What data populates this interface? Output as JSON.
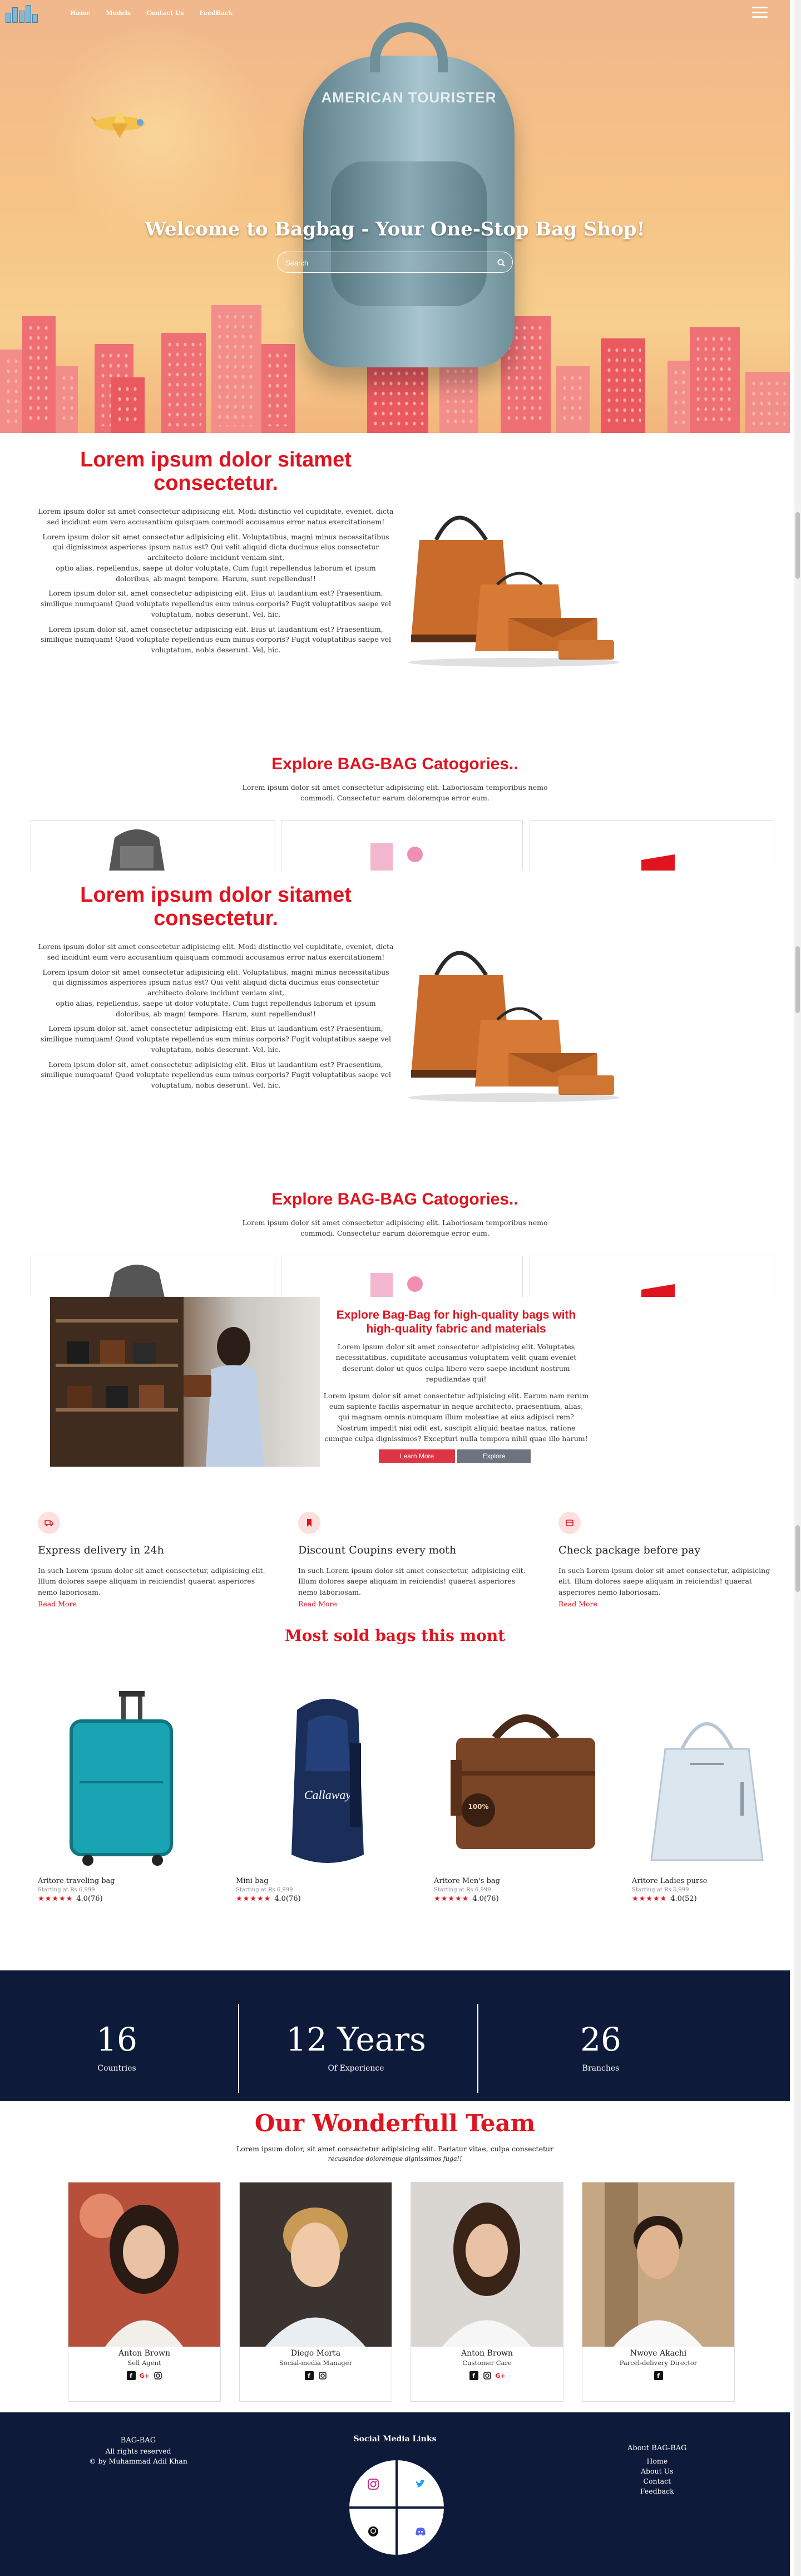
{
  "nav": {
    "links": [
      "Home",
      "Models",
      "Contact Us",
      "FeedBack"
    ]
  },
  "hero": {
    "title": "Welcome to Bagbag - Your One-Stop Bag Shop!",
    "search_placeholder": "Search",
    "backpack_brand": "AMERICAN TOURISTER"
  },
  "about": {
    "title": "Lorem ipsum dolor sitamet consectetur.",
    "paragraphs": [
      "Lorem ipsum dolor sit amet consectetur adipisicing elit. Modi distinctio vel cupiditate, eveniet, dicta sed incidunt eum vero accusantium quisquam commodi accusamus error natus exercitationem!",
      "Lorem ipsum dolor sit amet consectetur adipisicing elit. Voluptatibus, magni minus necessitatibus qui dignissimos asperiores ipsum natus est? Qui velit aliquid dicta ducimus eius consectetur architecto dolore incidunt veniam sint,",
      "optio alias, repellendus, saepe ut dolor voluptate. Cum fugit repellendus laborum et ipsum doloribus, ab magni tempore. Harum, sunt repellendus!!",
      "Lorem ipsum dolor sit, amet consectetur adipisicing elit. Eius ut laudantium est? Praesentium, similique numquam! Quod voluptate repellendus eum minus corporis? Fugit voluptatibus saepe vel voluptatum, nobis deserunt. Vel, hic.",
      "Lorem ipsum dolor sit, amet consectetur adipisicing elit. Eius ut laudantium est? Praesentium, similique numquam! Quod voluptate repellendus eum minus corporis? Fugit voluptatibus saepe vel voluptatum, nobis deserunt. Vel, hic."
    ]
  },
  "categories": {
    "title": "Explore BAG-BAG Catogories..",
    "subtitle": "Lorem ipsum dolor sit amet consectetur adipisicing elit. Laboriosam temporibus nemo commodi. Consectetur earum doloremque error eum."
  },
  "promo": {
    "title": "Explore Bag-Bag for high-quality bags with high-quality fabric and materials",
    "paragraphs": [
      "Lorem ipsum dolor sit amet consectetur adipisicing elit. Voluptates necessitatibus, cupiditate accusamus voluptatem velit quam eveniet deserunt dolor ut quos culpa libero vero saepe incidunt nostrum repudiandae qui!",
      "Lorem ipsum dolor sit amet consectetur adipisicing elit. Earum nam rerum eum sapiente facilis aspernatur in neque architecto, praesentium, alias, qui magnam omnis numquam illum molestiae at eius adipisci rem? Nostrum impedit nisi odit est, suscipit aliquid beatae natus, ratione cumque culpa dignissimos? Excepturi nulla tempora nihil quae illo harum!"
    ],
    "learn_more": "Learn More",
    "explore": "Explore"
  },
  "features": [
    {
      "title": "Express delivery in 24h",
      "text": "In such Lorem ipsum dolor sit amet consectetur, adipisicing elit. Illum dolores saepe aliquam in reiciendis! quaerat asperiores nemo laboriosam.",
      "link": "Read More",
      "icon": "truck-icon"
    },
    {
      "title": "Discount Coupins every moth",
      "text": "In such Lorem ipsum dolor sit amet consectetur, adipisicing elit. Illum dolores saepe aliquam in reiciendis! quaerat asperiores nemo laboriosam.",
      "link": "Read More",
      "icon": "bookmark-icon"
    },
    {
      "title": "Check package before pay",
      "text": "In such Lorem ipsum dolor sit amet consectetur, adipisicing elit. Illum dolores saepe aliquam in reiciendis! quaerat asperiores nemo laboriosam.",
      "link": "Read More",
      "icon": "package-icon"
    }
  ],
  "products": {
    "title": "Most sold bags this mont",
    "items": [
      {
        "name": "Aritore traveling bag",
        "price": "Starting at Rs 6,999",
        "rating": "4.0(76)"
      },
      {
        "name": "Mini bag",
        "price": "Starting at Rs 6,999",
        "rating": "4.0(76)"
      },
      {
        "name": "Aritore Men's bag",
        "price": "Starting at Rs 6,999",
        "rating": "4.0(76)"
      },
      {
        "name": "Aritore Ladies purse",
        "price": "Starting at Rs 5,999",
        "rating": "4.0(52)"
      }
    ]
  },
  "stats": [
    {
      "num": "16",
      "label": "Countries"
    },
    {
      "num": "12 Years",
      "label": "Of Experience"
    },
    {
      "num": "26",
      "label": "Branches"
    }
  ],
  "team": {
    "title": "Our Wonderfull Team",
    "subtitle_1": "Lorem ipsum dolor, sit amet consectetur adipisicing elit. Pariatur vitae, culpa consectetur",
    "subtitle_2": "recusandae doloremque dignissimos fuga!!",
    "members": [
      {
        "name": "Anton Brown",
        "role": "Sell Agent"
      },
      {
        "name": "Diego Morta",
        "role": "Social-media Manager"
      },
      {
        "name": "Anton Brown",
        "role": "Customer Care"
      },
      {
        "name": "Nwoye Akachi",
        "role": "Parcel-delivery Director"
      }
    ]
  },
  "footer": {
    "brand": "BAG-BAG",
    "rights": "All rights reserved",
    "by": "© by Muhammad Adil Khan",
    "social_title": "Social Media Links",
    "about_title": "About BAG-BAG",
    "links": [
      "Home",
      "About Us",
      "Contact",
      "Feedback"
    ]
  },
  "colors": {
    "accent": "#e0141f",
    "navy": "#0e1a3a"
  }
}
